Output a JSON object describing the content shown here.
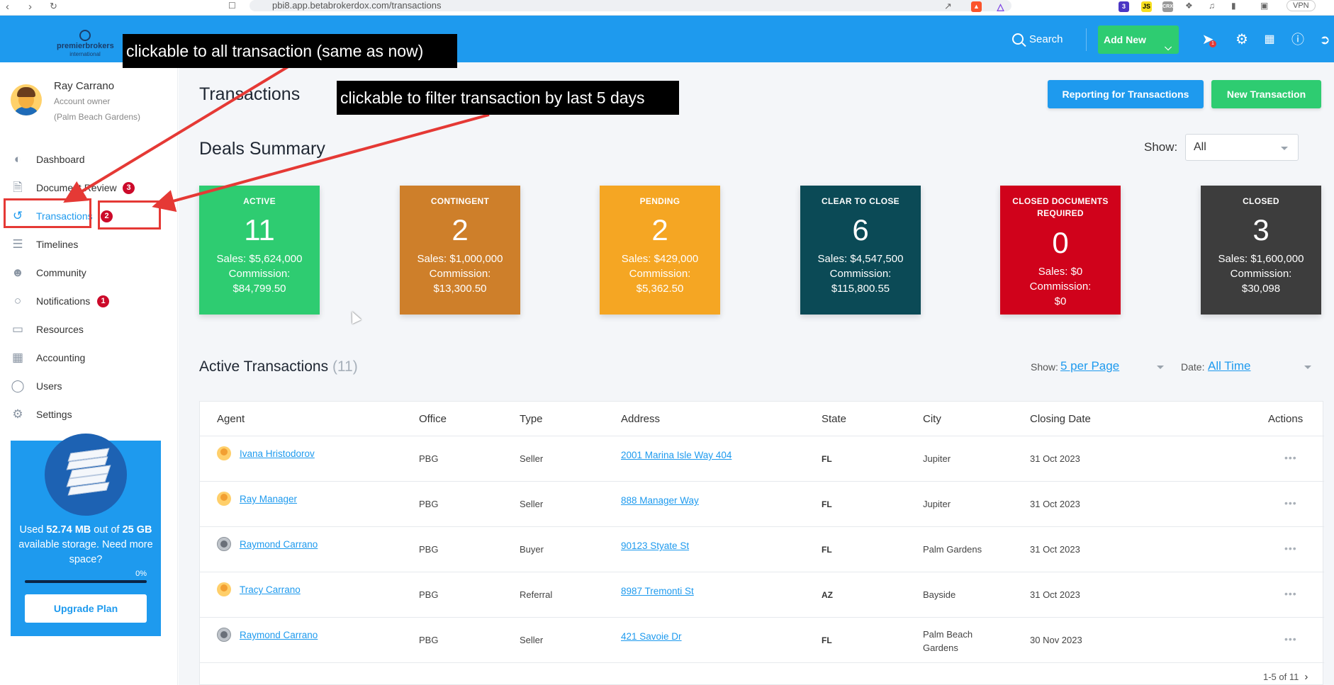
{
  "browser": {
    "url": "pbi8.app.betabrokerdox.com/transactions",
    "ext_js": "JS",
    "ext_crx": "CRX",
    "ext_badge": "3",
    "vpn": "VPN"
  },
  "topbar": {
    "logo_line1": "premierbrokers",
    "logo_line2": "international",
    "search_label": "Search",
    "add_new_label": "Add New",
    "notification_badge": "1",
    "icons": [
      "rocket-icon",
      "gear-icon",
      "calculator-icon",
      "help-icon",
      "logout-icon"
    ]
  },
  "user": {
    "name": "Ray Carrano",
    "role": "Account owner",
    "office": "(Palm Beach Gardens)"
  },
  "sidebar": {
    "items": [
      {
        "label": "Dashboard",
        "icon": "gauge-icon",
        "badge": ""
      },
      {
        "label": "Document Review",
        "icon": "document-icon",
        "badge": "3"
      },
      {
        "label": "Transactions",
        "icon": "history-icon",
        "badge": "2",
        "active": true
      },
      {
        "label": "Timelines",
        "icon": "timeline-icon",
        "badge": ""
      },
      {
        "label": "Community",
        "icon": "community-icon",
        "badge": ""
      },
      {
        "label": "Notifications",
        "icon": "chat-icon",
        "badge": "1"
      },
      {
        "label": "Resources",
        "icon": "folder-icon",
        "badge": ""
      },
      {
        "label": "Accounting",
        "icon": "accounting-icon",
        "badge": ""
      },
      {
        "label": "Users",
        "icon": "user-icon",
        "badge": ""
      },
      {
        "label": "Settings",
        "icon": "gear-icon",
        "badge": ""
      }
    ],
    "storage": {
      "text_prefix": "Used ",
      "used": "52.74 MB",
      "text_mid": " out of ",
      "total": "25 GB",
      "text_suffix": " available storage. Need more space?",
      "percent_label": "0%",
      "fraction": 0,
      "upgrade_label": "Upgrade Plan"
    }
  },
  "page": {
    "title": "Transactions",
    "reporting_label": "Reporting for Transactions",
    "new_transaction_label": "New Transaction",
    "summary_title": "Deals Summary",
    "show_label": "Show:",
    "show_value": "All"
  },
  "cards": [
    {
      "label_lines": [
        "ACTIVE"
      ],
      "count": "11",
      "sales": "Sales: $5,624,000",
      "commission_label": "Commission:",
      "commission": "$84,799.50",
      "color": "#2ecc71"
    },
    {
      "label_lines": [
        "CONTINGENT"
      ],
      "count": "2",
      "sales": "Sales: $1,000,000",
      "commission_label": "Commission:",
      "commission": "$13,300.50",
      "color": "#ce7f2a"
    },
    {
      "label_lines": [
        "PENDING"
      ],
      "count": "2",
      "sales": "Sales: $429,000",
      "commission_label": "Commission:",
      "commission": "$5,362.50",
      "color": "#f5a623"
    },
    {
      "label_lines": [
        "CLEAR TO CLOSE"
      ],
      "count": "6",
      "sales": "Sales: $4,547,500",
      "commission_label": "Commission:",
      "commission": "$115,800.55",
      "color": "#0b4a56"
    },
    {
      "label_lines": [
        "CLOSED DOCUMENTS",
        "REQUIRED"
      ],
      "count": "0",
      "sales": "Sales: $0",
      "commission_label": "Commission:",
      "commission": "$0",
      "color": "#d0021b"
    },
    {
      "label_lines": [
        "CLOSED"
      ],
      "count": "3",
      "sales": "Sales: $1,600,000",
      "commission_label": "Commission:",
      "commission": "$30,098",
      "color": "#3d3d3d"
    }
  ],
  "active_section": {
    "title": "Active Transactions",
    "count": "(11)",
    "show_label": "Show:",
    "per_page": "5 per Page",
    "date_label": "Date:",
    "date_value": "All Time"
  },
  "table": {
    "headers": [
      "Agent",
      "Office",
      "Type",
      "Address",
      "State",
      "City",
      "Closing Date",
      "Actions"
    ],
    "rows": [
      {
        "agent": "Ivana Hristodorov",
        "avatar": "orange",
        "office": "PBG",
        "type": "Seller",
        "address": "2001 Marina Isle Way 404",
        "state": "FL",
        "city": "Jupiter",
        "closing": "31 Oct 2023"
      },
      {
        "agent": "Ray Manager",
        "avatar": "orange",
        "office": "PBG",
        "type": "Seller",
        "address": "888 Manager Way",
        "state": "FL",
        "city": "Jupiter",
        "closing": "31 Oct 2023"
      },
      {
        "agent": "Raymond Carrano",
        "avatar": "gray",
        "office": "PBG",
        "type": "Buyer",
        "address": "90123 Styate St",
        "state": "FL",
        "city": "Palm Gardens",
        "closing": "31 Oct 2023"
      },
      {
        "agent": "Tracy Carrano",
        "avatar": "orange",
        "office": "PBG",
        "type": "Referral",
        "address": "8987 Tremonti St",
        "state": "AZ",
        "city": "Bayside",
        "closing": "31 Oct 2023"
      },
      {
        "agent": "Raymond Carrano",
        "avatar": "gray",
        "office": "PBG",
        "type": "Seller",
        "address": "421 Savoie Dr",
        "state": "FL",
        "city": "Palm Beach Gardens",
        "closing": "30 Nov 2023"
      }
    ],
    "actions_glyph": "•••",
    "pagination": "1-5 of 11"
  },
  "annotations": {
    "note1": "clickable to all transaction (same as now)",
    "note2": "clickable to filter transaction by last 5 days",
    "color": "#e53935"
  }
}
